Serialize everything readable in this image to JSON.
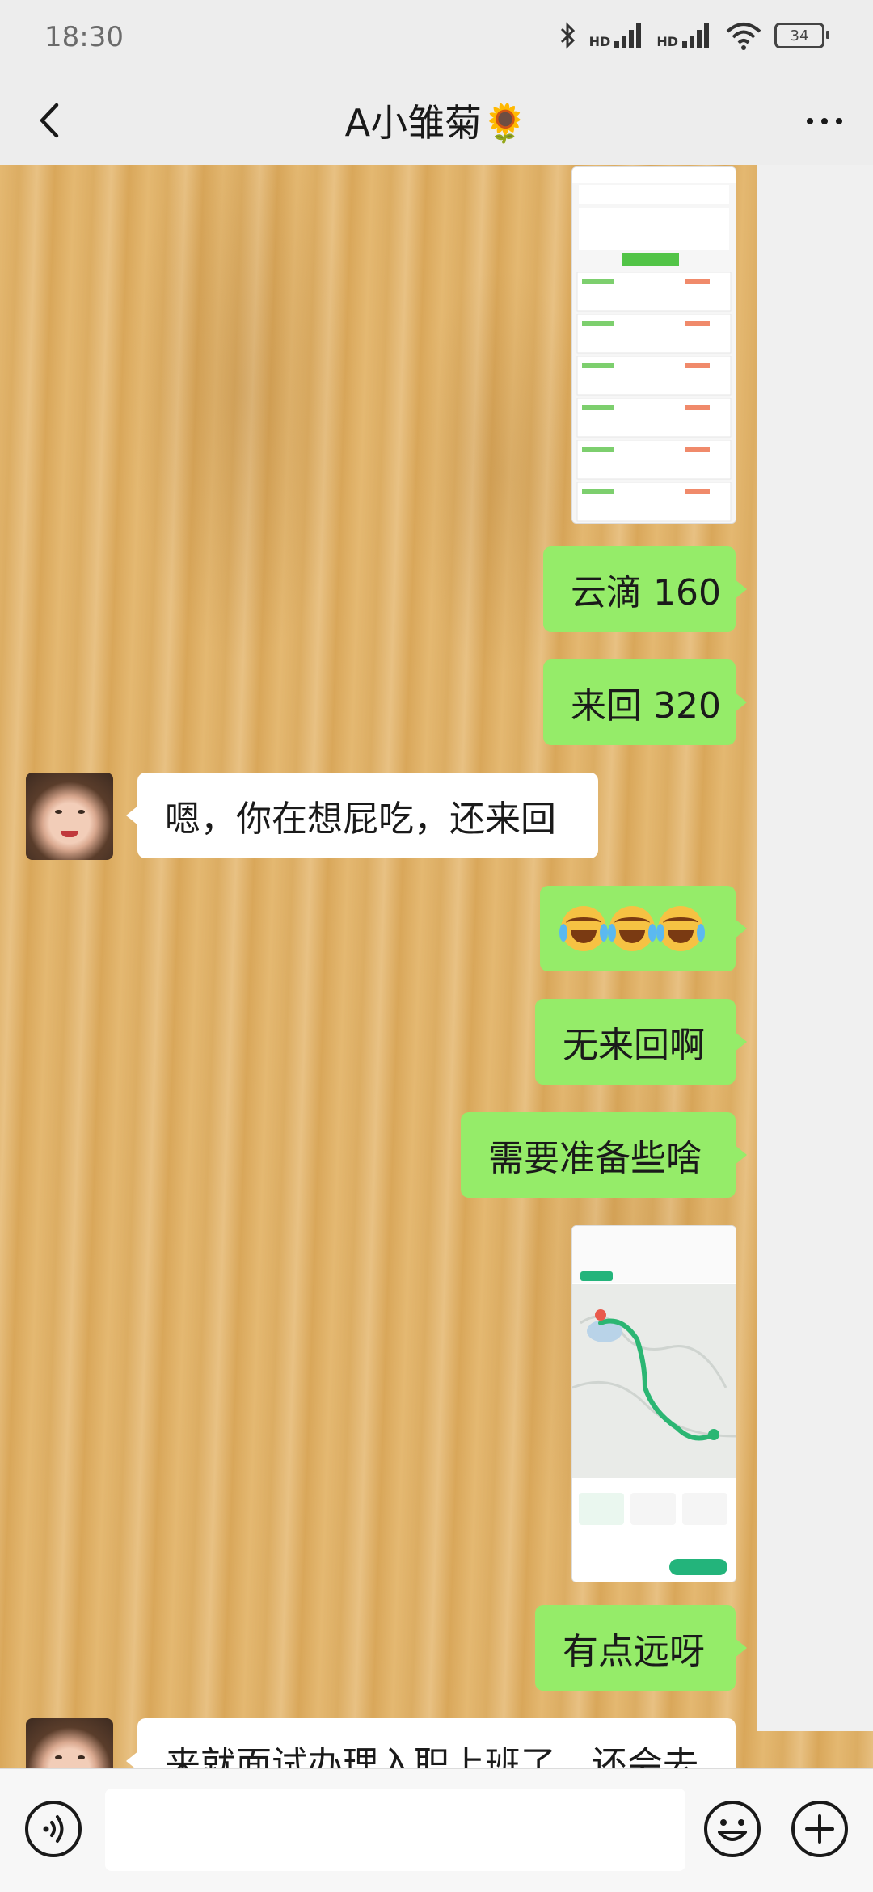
{
  "status_bar": {
    "time": "18:30",
    "network_1": "HD",
    "network_2": "HD",
    "battery": "34"
  },
  "header": {
    "title": "A小雏菊🌻"
  },
  "messages": [
    {
      "side": "right",
      "type": "image",
      "icon": "screenshot-ride-list"
    },
    {
      "side": "right",
      "type": "text",
      "text": "云滴 160"
    },
    {
      "side": "right",
      "type": "text",
      "text": "来回 320"
    },
    {
      "side": "left",
      "type": "text",
      "text": "嗯，你在想屁吃，还来回"
    },
    {
      "side": "right",
      "type": "emoji",
      "icon": "laughing-crying-face",
      "count": 3
    },
    {
      "side": "right",
      "type": "text",
      "text": "无来回啊"
    },
    {
      "side": "right",
      "type": "text",
      "text": "需要准备些啥"
    },
    {
      "side": "right",
      "type": "image",
      "icon": "screenshot-map-route"
    },
    {
      "side": "right",
      "type": "text",
      "text": "有点远呀"
    },
    {
      "side": "left",
      "type": "text",
      "text": "来就面试办理入职上班了，还会去"
    }
  ],
  "colors": {
    "outgoing_bubble": "#95ec69",
    "incoming_bubble": "#ffffff",
    "bars": "#ededed"
  }
}
